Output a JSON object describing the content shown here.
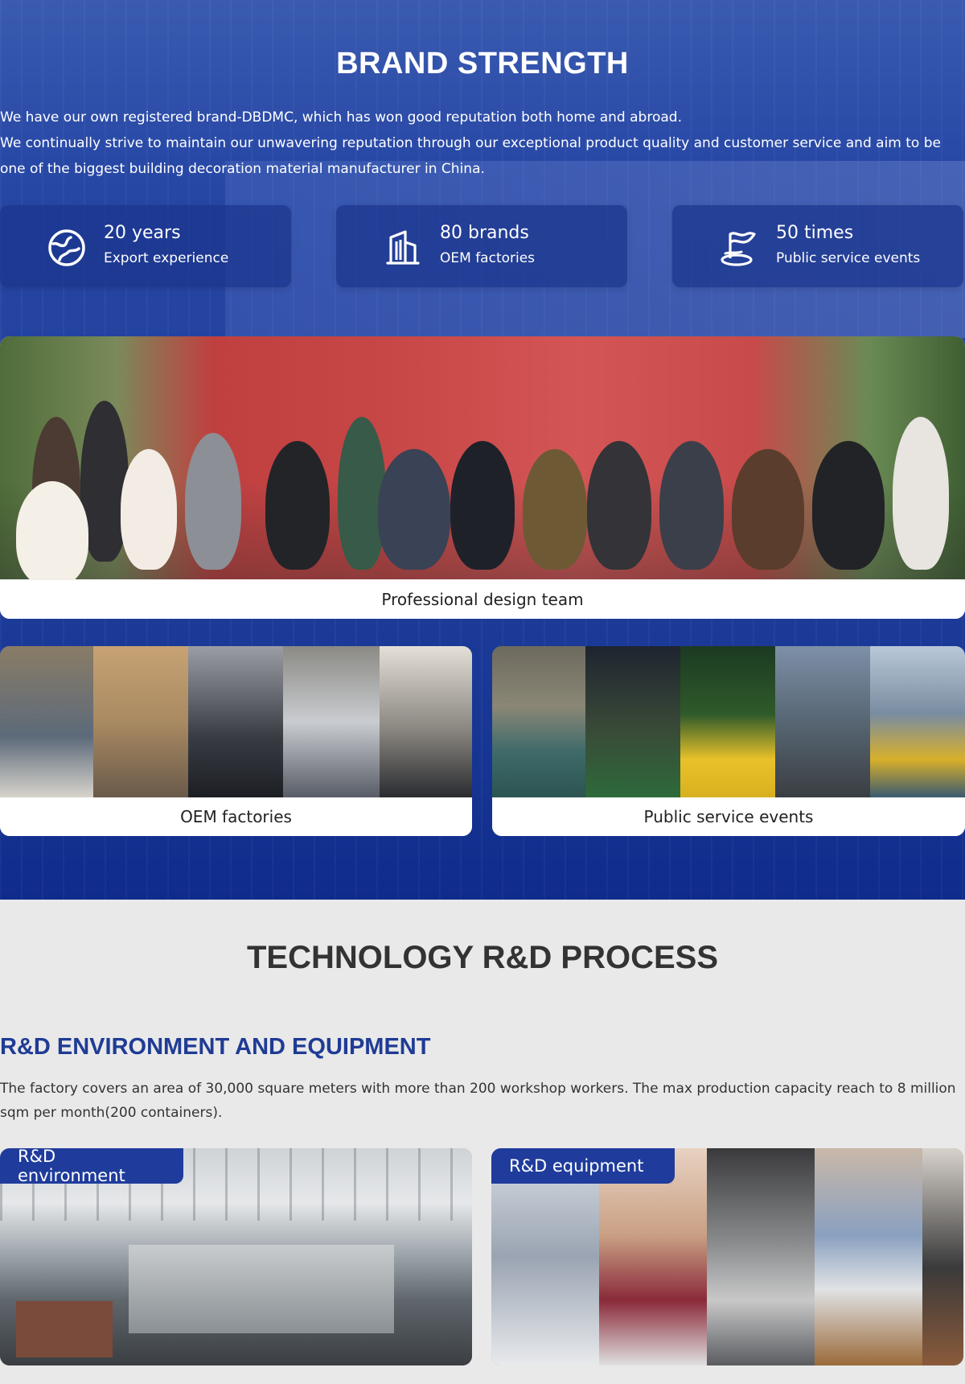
{
  "brand": {
    "title": "BRAND STRENGTH",
    "paragraph_1": "We have our own registered brand-DBDMC, which has won good reputation both home and abroad.",
    "paragraph_2": "We continually strive to maintain our unwavering reputation through our exceptional product quality and customer service and aim to be one of the biggest building decoration material manufacturer in China.",
    "stats": [
      {
        "value": "20 years",
        "label": "Export experience",
        "icon": "globe-icon"
      },
      {
        "value": "80 brands",
        "label": "OEM factories",
        "icon": "building-icon"
      },
      {
        "value": "50 times",
        "label": "Public service events",
        "icon": "flag-icon"
      }
    ],
    "photos": {
      "team_caption": "Professional design team",
      "oem_caption": "OEM factories",
      "public_caption": "Public service events"
    }
  },
  "tech": {
    "title": "TECHNOLOGY R&D PROCESS",
    "subtitle": "R&D ENVIRONMENT AND EQUIPMENT",
    "text": "The factory covers an area of 30,000 square meters with more than 200 workshop workers. The max production capacity reach to 8 million sqm per month(200 containers).",
    "cards": [
      {
        "tag": "R&D environment"
      },
      {
        "tag": "R&D equipment"
      }
    ]
  },
  "colors": {
    "brand_blue": "#1f3c9c",
    "heading_dark": "#333333",
    "background_gray": "#e9e9e9"
  }
}
